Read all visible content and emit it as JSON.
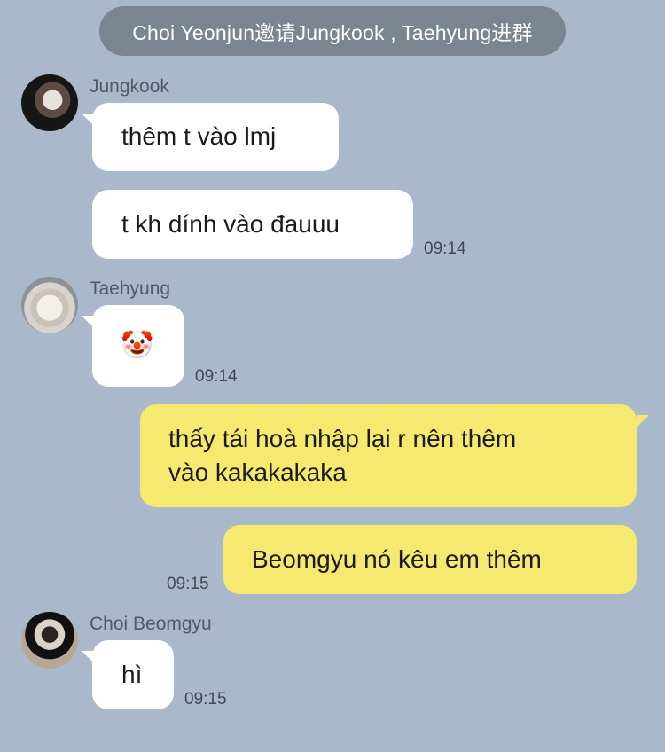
{
  "system_notice": "Choi Yeonjun邀请Jungkook , Taehyung进群",
  "messages": [
    {
      "sender": "Jungkook",
      "text": "thêm t vào lmj"
    },
    {
      "text": "t kh dính vào đauuu",
      "time": "09:14"
    },
    {
      "sender": "Taehyung",
      "text": "🤡",
      "time": "09:14"
    },
    {
      "text_line1": "thấy tái hoà nhập lại r nên thêm",
      "text_line2": "vào kakakakaka"
    },
    {
      "text": "Beomgyu nó kêu em thêm",
      "time": "09:15"
    },
    {
      "sender": "Choi Beomgyu",
      "text": "hì",
      "time": "09:15"
    }
  ],
  "colors": {
    "background": "#a9b8cb",
    "incoming_bubble": "#ffffff",
    "outgoing_bubble": "#f6e96f",
    "system_pill": "#7b8591"
  }
}
